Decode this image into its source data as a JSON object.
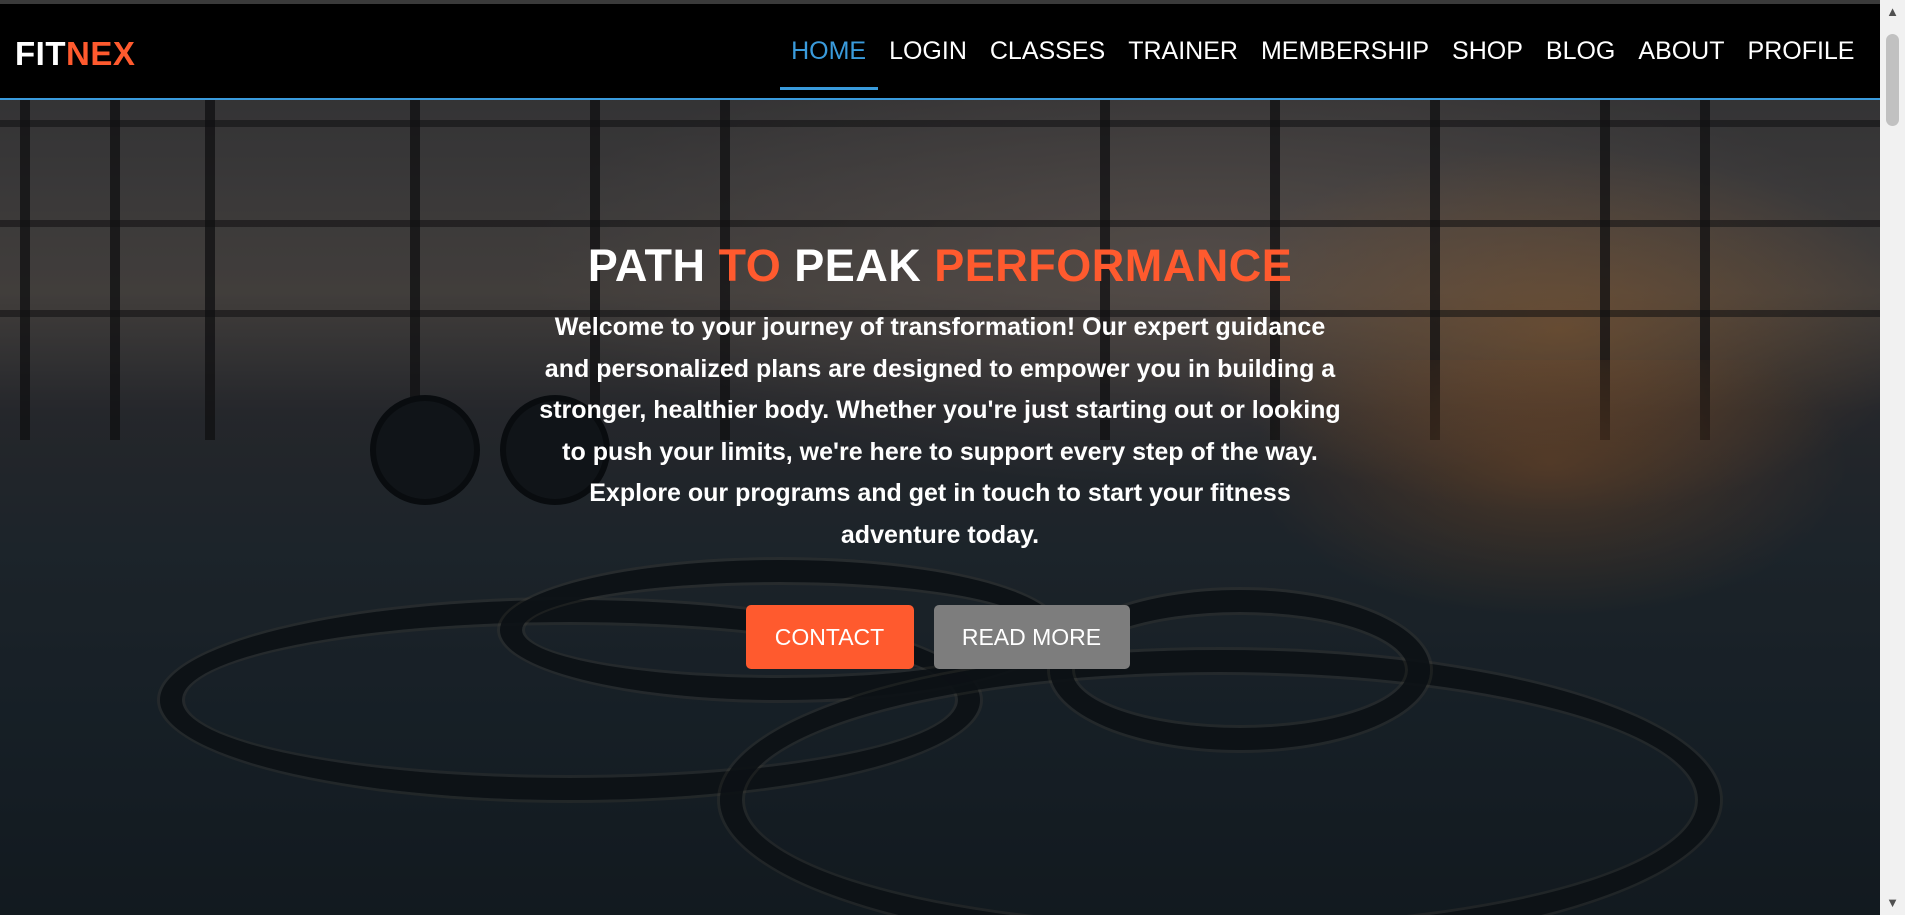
{
  "brand": {
    "part1": "FIT",
    "part2": "NEX"
  },
  "nav": {
    "items": [
      {
        "label": "HOME",
        "active": true
      },
      {
        "label": "LOGIN"
      },
      {
        "label": "CLASSES"
      },
      {
        "label": "TRAINER"
      },
      {
        "label": "MEMBERSHIP"
      },
      {
        "label": "SHOP"
      },
      {
        "label": "BLOG"
      },
      {
        "label": "ABOUT"
      },
      {
        "label": "PROFILE"
      }
    ]
  },
  "hero": {
    "title": {
      "w1": "PATH ",
      "o1": "TO",
      "w2": " PEAK ",
      "o2": "PERFORMANCE"
    },
    "text": "Welcome to your journey of transformation! Our expert guidance and personalized plans are designed to empower you in building a stronger, healthier body. Whether you're just starting out or looking to push your limits, we're here to support every step of the way. Explore our programs and get in touch to start your fitness adventure today.",
    "buttons": {
      "contact": "CONTACT",
      "read_more": "READ MORE"
    }
  },
  "colors": {
    "accent": "#ff5a2e",
    "active_nav": "#3a9bdc",
    "secondary_button": "#7d7d7d"
  },
  "scrollbar": {
    "up_icon": "chevron-up-icon",
    "down_icon": "chevron-down-icon"
  }
}
